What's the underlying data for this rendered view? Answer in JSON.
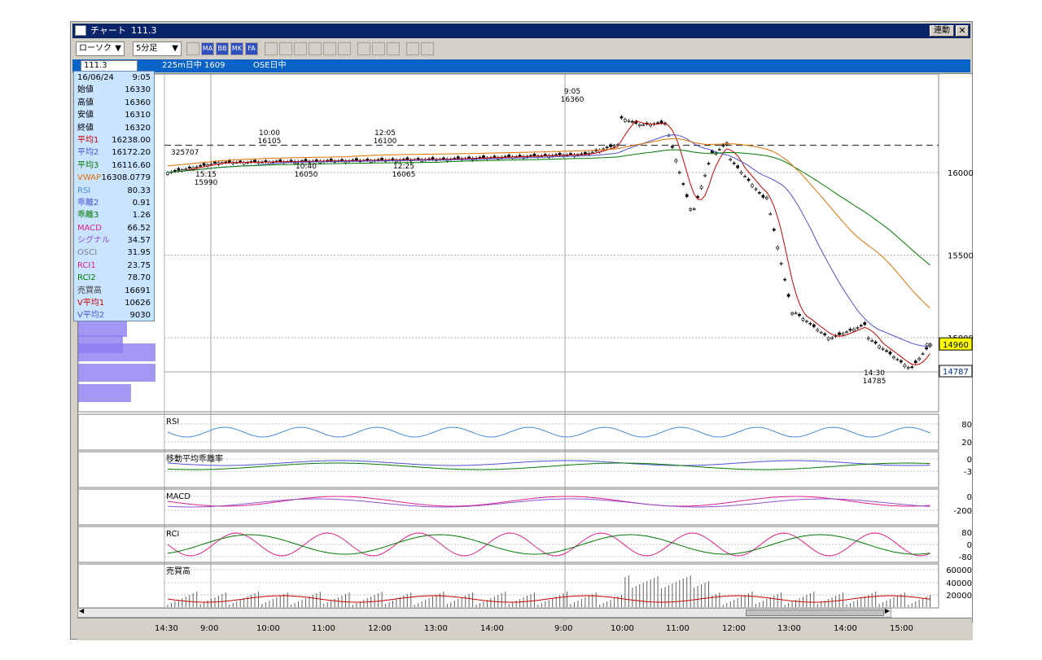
{
  "window": {
    "title": "チャート",
    "code_title": "111.3",
    "link_label": "連動",
    "close_glyph": "✕"
  },
  "toolbar": {
    "chart_type": "ローソク",
    "interval": "5分足",
    "buttons": [
      "chart-icon",
      "ma-icon",
      "bb-icon",
      "ichimoku-icon",
      "fa-icon",
      "line-icon",
      "point-figure-icon",
      "volume-icon",
      "zoom-icon",
      "table-icon",
      "new-icon",
      "pen-icon",
      "cursor-icon",
      "eraser-icon",
      "settings-icon",
      "compare-icon"
    ],
    "button_labels": {
      "ma": "MA",
      "bb": "BB",
      "ichimoku": "MK",
      "fa": "FA"
    }
  },
  "infobar": {
    "code": "111.3",
    "instrument": "225m日中 1609",
    "market": "OSE日中"
  },
  "info_panel": [
    {
      "label": "16/06/24",
      "value": "9:05",
      "color": "#000"
    },
    {
      "label": "始値",
      "value": "16330",
      "color": "#000"
    },
    {
      "label": "高値",
      "value": "16360",
      "color": "#000"
    },
    {
      "label": "安値",
      "value": "16310",
      "color": "#000"
    },
    {
      "label": "終値",
      "value": "16320",
      "color": "#000"
    },
    {
      "label": "平均1",
      "value": "16238.00",
      "color": "#cc0000"
    },
    {
      "label": "平均2",
      "value": "16172.20",
      "color": "#5050d0"
    },
    {
      "label": "平均3",
      "value": "16116.60",
      "color": "#007a00"
    },
    {
      "label": "VWAP",
      "value": "16308.0779",
      "color": "#e07000"
    },
    {
      "label": "RSI",
      "value": "80.33",
      "color": "#4a8ad0"
    },
    {
      "label": "乖離2",
      "value": "0.91",
      "color": "#5050d0"
    },
    {
      "label": "乖離3",
      "value": "1.26",
      "color": "#007a00"
    },
    {
      "label": "MACD",
      "value": "66.52",
      "color": "#e0208a"
    },
    {
      "label": "シグナル",
      "value": "34.57",
      "color": "#9050d0"
    },
    {
      "label": "OSCI",
      "value": "31.95",
      "color": "#808080"
    },
    {
      "label": "RCI1",
      "value": "23.75",
      "color": "#e0208a"
    },
    {
      "label": "RCI2",
      "value": "78.70",
      "color": "#007a00"
    },
    {
      "label": "売買高",
      "value": "16691",
      "color": "#404040"
    },
    {
      "label": "V平均1",
      "value": "10626",
      "color": "#cc0000"
    },
    {
      "label": "V平均2",
      "value": "9030",
      "color": "#5050d0"
    }
  ],
  "main_chart": {
    "y_ticks": [
      "16000",
      "15500",
      "15000"
    ],
    "last_price": "14960",
    "low_marker": "14787",
    "annotations": [
      {
        "time": "10:00",
        "price": "16105"
      },
      {
        "time": "12:05",
        "price": "16100"
      },
      {
        "time": "9:05",
        "price": "16360"
      },
      {
        "time": "15:15",
        "price": "15990"
      },
      {
        "time": "10:40",
        "price": "16050"
      },
      {
        "time": "12:25",
        "price": "16065"
      },
      {
        "time": "14:30",
        "price": "14785"
      }
    ],
    "volume_profile_label": "325707"
  },
  "sub_panels": {
    "rsi": {
      "title": "RSI",
      "ticks": [
        "80",
        "20"
      ]
    },
    "deviation": {
      "title": "移動平均乖離率",
      "ticks": [
        "0",
        "-3"
      ]
    },
    "macd": {
      "title": "MACD",
      "ticks": [
        "0",
        "-200"
      ]
    },
    "rci": {
      "title": "RCI",
      "ticks": [
        "80",
        "0",
        "-80"
      ]
    },
    "volume": {
      "title": "売買高",
      "ticks": [
        "60000",
        "40000",
        "20000"
      ]
    }
  },
  "time_axis": [
    "14:30",
    "9:00",
    "10:00",
    "11:00",
    "12:00",
    "13:00",
    "14:00",
    "9:00",
    "10:00",
    "11:00",
    "12:00",
    "13:00",
    "14:00",
    "15:00"
  ],
  "scroll": {
    "left_arrow": "◀",
    "right_arrow": "▶"
  },
  "colors": {
    "title_bg": "#0a246a",
    "info_bg": "#0a64c8",
    "ma1": "#cc0000",
    "ma2": "#5050d0",
    "ma3": "#007a00",
    "vwap": "#e07000",
    "rsi": "#4a8ad0"
  }
}
